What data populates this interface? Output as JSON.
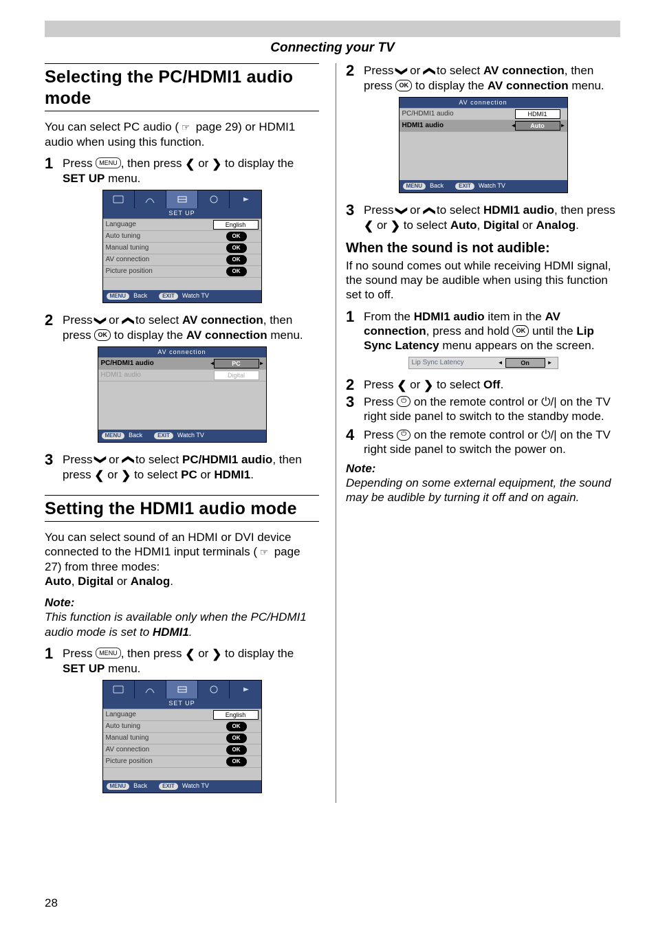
{
  "page": {
    "header": "Connecting your TV",
    "number": "28"
  },
  "sec1": {
    "title": "Selecting the PC/HDMI1 audio mode",
    "intro_a": "You can select PC audio (",
    "intro_b": " page 29) or HDMI1 audio when using this function.",
    "s1_a": "Press ",
    "s1_b": ", then press ",
    "s1_c": " or ",
    "s1_d": " to display the ",
    "s1_e": "SET UP",
    "s1_f": " menu.",
    "s2_a": "Press ",
    "s2_b": " or ",
    "s2_c": " to select ",
    "s2_d": "AV connection",
    "s2_e": ", then press ",
    "s2_f": " to display the ",
    "s2_g": "AV connection",
    "s2_h": " menu.",
    "s3_a": "Press ",
    "s3_b": " or ",
    "s3_c": " to select ",
    "s3_d": "PC/HDMI1 audio",
    "s3_e": ", then press ",
    "s3_f": " or ",
    "s3_g": " to select ",
    "s3_h": "PC",
    "s3_i": " or ",
    "s3_j": "HDMI1",
    "s3_k": "."
  },
  "sec2": {
    "title": "Setting the HDMI1 audio mode",
    "p1_a": "You can select sound of an HDMI or DVI device connected to the HDMI1 input terminals (",
    "p1_b": " page 27) from three modes:",
    "p1_c": "Auto",
    "p1_d": ", ",
    "p1_e": "Digital",
    "p1_f": " or ",
    "p1_g": "Analog",
    "p1_h": ".",
    "note_head": "Note:",
    "note_body_a": "This function is available only when the PC/HDMI1 audio mode is set to ",
    "note_body_b": "HDMI1",
    "note_body_c": ".",
    "s1_a": "Press ",
    "s1_b": ", then press ",
    "s1_c": " or ",
    "s1_d": " to display the ",
    "s1_e": "SET UP",
    "s1_f": " menu."
  },
  "right": {
    "s2_a": "Press ",
    "s2_b": " or ",
    "s2_c": " to select ",
    "s2_d": "AV connection",
    "s2_e": ", then press ",
    "s2_f": " to display the ",
    "s2_g": "AV connection",
    "s2_h": " menu.",
    "s3_a": "Press ",
    "s3_b": " or ",
    "s3_c": " to select ",
    "s3_d": "HDMI1 audio",
    "s3_e": ", then press ",
    "s3_f": " or ",
    "s3_g": " to select ",
    "s3_h": "Auto",
    "s3_i": ", ",
    "s3_j": "Digital",
    "s3_k": " or ",
    "s3_l": "Analog",
    "s3_m": ".",
    "sub": "When the sound is not audible:",
    "sub_body": "If no sound comes out while receiving HDMI signal, the sound may be audible when using this function set to off.",
    "r1_a": "From the ",
    "r1_b": "HDMI1 audio",
    "r1_c": " item in the ",
    "r1_d": "AV connection",
    "r1_e": ", press and hold ",
    "r1_f": " until the ",
    "r1_g": "Lip Sync Latency",
    "r1_h": " menu appears on the screen.",
    "lip_label": "Lip Sync Latency",
    "lip_value": "On",
    "r2_a": "Press ",
    "r2_b": " or ",
    "r2_c": " to select ",
    "r2_d": "Off",
    "r2_e": ".",
    "r3_a": "Press ",
    "r3_b": " on the remote control or ",
    "r3_c": " on the TV right side panel to switch to the standby mode.",
    "r4_a": "Press ",
    "r4_b": " on the remote control or ",
    "r4_c": " on the TV right side panel to switch the power on.",
    "note_head": "Note:",
    "note_body": "Depending on some external equipment, the sound may be audible by turning it off and on again."
  },
  "menus": {
    "setup_title": "SET UP",
    "rows": {
      "lang": "Language",
      "lang_v": "English",
      "auto": "Auto tuning",
      "manual": "Manual tuning",
      "av": "AV connection",
      "pic": "Picture position"
    },
    "avc_title": "AV connection",
    "avc": {
      "pc": "PC/HDMI1 audio",
      "pc_v": "PC",
      "h1": "HDMI1 audio",
      "h1_v": "Digital",
      "pc2_v": "HDMI1",
      "h2_v": "Auto"
    },
    "footer": {
      "back": "Back",
      "watch": "Watch TV",
      "menu": "MENU",
      "exit": "EXIT"
    },
    "ok": "OK"
  },
  "icons": {
    "menu_btn": "MENU",
    "ok_btn": "OK",
    "hand": "☞",
    "left": "❮",
    "right": "❯",
    "up": "❯",
    "down": "❯",
    "power": "⏻",
    "power2": "⏻/|"
  }
}
